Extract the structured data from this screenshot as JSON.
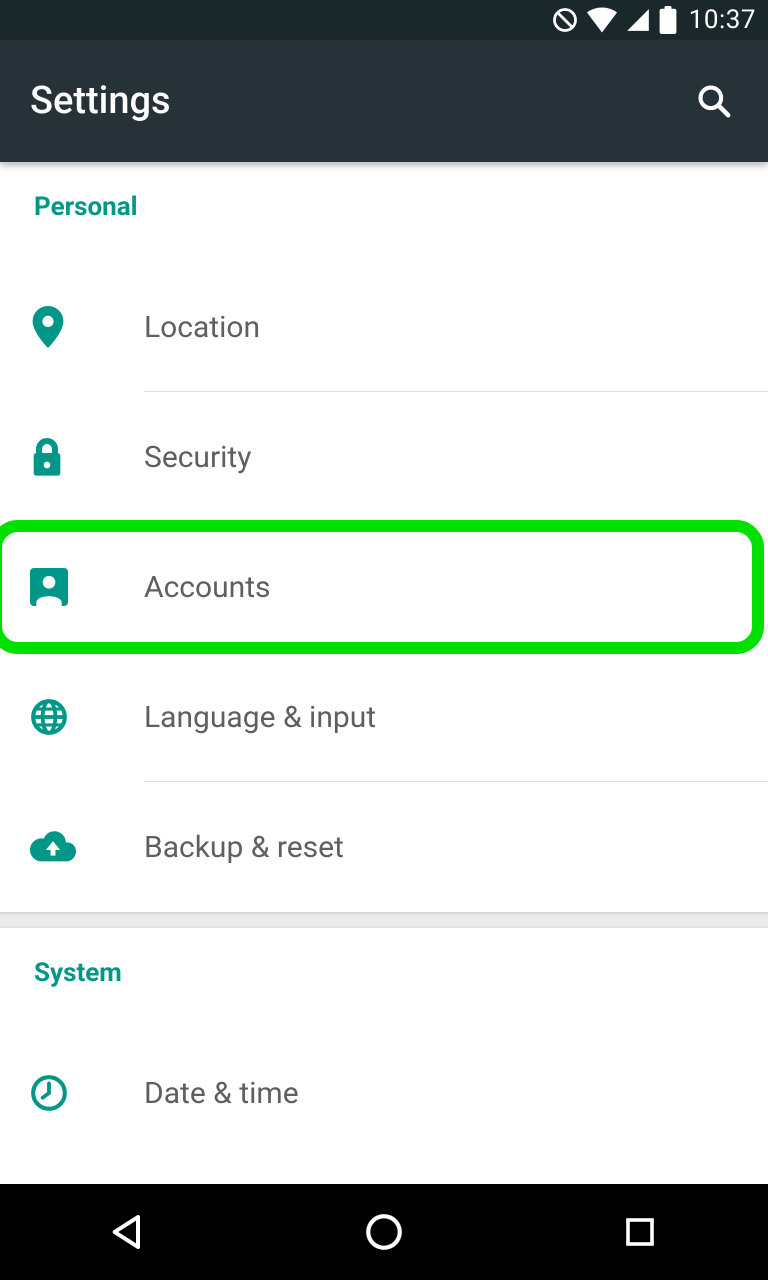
{
  "status_bar": {
    "time": "10:37",
    "icons": [
      "no-sign-icon",
      "wifi-icon",
      "cell-signal-icon",
      "battery-icon"
    ]
  },
  "app_bar": {
    "title": "Settings",
    "search_action": "search-icon"
  },
  "colors": {
    "accent": "#009688",
    "status_bg": "#1a272b",
    "appbar_bg": "#263238",
    "highlight": "#00e000"
  },
  "sections": [
    {
      "header": "Personal",
      "items": [
        {
          "icon": "location-icon",
          "label": "Location",
          "highlighted": false
        },
        {
          "icon": "lock-icon",
          "label": "Security",
          "highlighted": false
        },
        {
          "icon": "person-icon",
          "label": "Accounts",
          "highlighted": true
        },
        {
          "icon": "globe-icon",
          "label": "Language & input",
          "highlighted": false
        },
        {
          "icon": "cloud-upload-icon",
          "label": "Backup & reset",
          "highlighted": false
        }
      ]
    },
    {
      "header": "System",
      "items": [
        {
          "icon": "clock-icon",
          "label": "Date & time",
          "highlighted": false
        }
      ]
    }
  ]
}
